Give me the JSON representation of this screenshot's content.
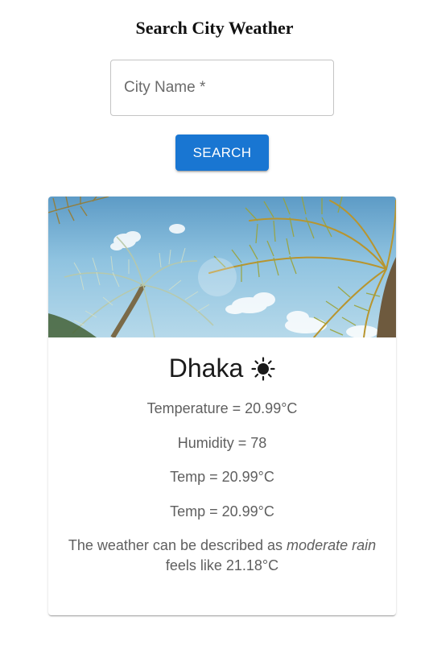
{
  "header": {
    "title": "Search City Weather"
  },
  "search": {
    "placeholder": "City Name *",
    "value": "",
    "button_label": "SEARCH"
  },
  "weather_card": {
    "image": {
      "subject": "palm-trees-against-blue-sky"
    },
    "city": "Dhaka",
    "condition_icon": "sun-icon",
    "temperature": "Temperature = 20.99°C",
    "humidity": "Humidity = 78",
    "temp_line_1": "Temp = 20.99°C",
    "temp_line_2": "Temp = 20.99°C",
    "description_prefix": "The weather can be described as ",
    "description_value": "moderate rain",
    "feels_like": "feels like 21.18°C"
  },
  "colors": {
    "primary": "#1976d2",
    "text_secondary": "#5f5f5f",
    "border": "#c4c4c4"
  }
}
